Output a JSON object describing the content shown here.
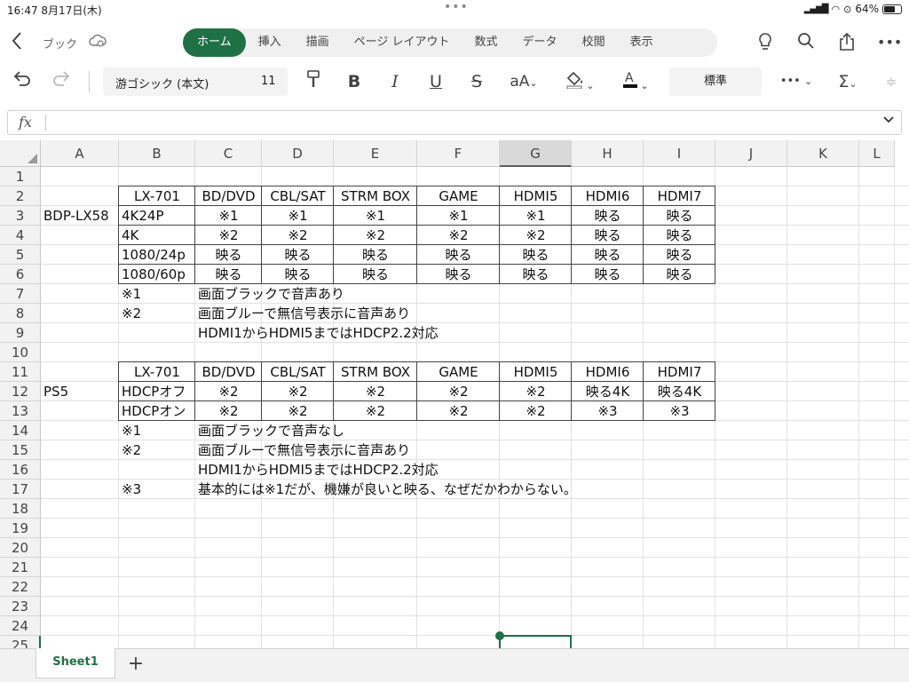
{
  "status": {
    "time": "16:47",
    "date": "8月17日(木)",
    "battery_text": "64%",
    "battery_level": 0.64
  },
  "ribbon": {
    "breadcrumb": "ブック",
    "tabs": [
      "ホーム",
      "挿入",
      "描画",
      "ページ レイアウト",
      "数式",
      "データ",
      "校閲",
      "表示"
    ],
    "active_tab": "ホーム"
  },
  "toolbar": {
    "font_name": "游ゴシック (本文)",
    "font_size": "11",
    "number_format": "標準"
  },
  "formula_bar": {
    "fx_label": "fx",
    "value": ""
  },
  "columns": [
    "A",
    "B",
    "C",
    "D",
    "E",
    "F",
    "G",
    "H",
    "I",
    "J",
    "K",
    "L"
  ],
  "selected_column": "G",
  "rows": [
    "1",
    "2",
    "3",
    "4",
    "5",
    "6",
    "7",
    "8",
    "9",
    "10",
    "11",
    "12",
    "13",
    "14",
    "15",
    "16",
    "17",
    "18",
    "19",
    "20",
    "21",
    "22",
    "23",
    "24",
    "25"
  ],
  "cells": [
    {
      "r": 2,
      "c": "B",
      "v": "LX-701",
      "al": "c"
    },
    {
      "r": 2,
      "c": "C",
      "v": "BD/DVD",
      "al": "c"
    },
    {
      "r": 2,
      "c": "D",
      "v": "CBL/SAT",
      "al": "c"
    },
    {
      "r": 2,
      "c": "E",
      "v": "STRM BOX",
      "al": "c"
    },
    {
      "r": 2,
      "c": "F",
      "v": "GAME",
      "al": "c"
    },
    {
      "r": 2,
      "c": "G",
      "v": "HDMI5",
      "al": "c"
    },
    {
      "r": 2,
      "c": "H",
      "v": "HDMI6",
      "al": "c"
    },
    {
      "r": 2,
      "c": "I",
      "v": "HDMI7",
      "al": "c"
    },
    {
      "r": 3,
      "c": "A",
      "v": "BDP-LX58",
      "al": "l"
    },
    {
      "r": 3,
      "c": "B",
      "v": "4K24P",
      "al": "l"
    },
    {
      "r": 3,
      "c": "C",
      "v": "※1",
      "al": "c"
    },
    {
      "r": 3,
      "c": "D",
      "v": "※1",
      "al": "c"
    },
    {
      "r": 3,
      "c": "E",
      "v": "※1",
      "al": "c"
    },
    {
      "r": 3,
      "c": "F",
      "v": "※1",
      "al": "c"
    },
    {
      "r": 3,
      "c": "G",
      "v": "※1",
      "al": "c"
    },
    {
      "r": 3,
      "c": "H",
      "v": "映る",
      "al": "c"
    },
    {
      "r": 3,
      "c": "I",
      "v": "映る",
      "al": "c"
    },
    {
      "r": 4,
      "c": "B",
      "v": "4K",
      "al": "l"
    },
    {
      "r": 4,
      "c": "C",
      "v": "※2",
      "al": "c"
    },
    {
      "r": 4,
      "c": "D",
      "v": "※2",
      "al": "c"
    },
    {
      "r": 4,
      "c": "E",
      "v": "※2",
      "al": "c"
    },
    {
      "r": 4,
      "c": "F",
      "v": "※2",
      "al": "c"
    },
    {
      "r": 4,
      "c": "G",
      "v": "※2",
      "al": "c"
    },
    {
      "r": 4,
      "c": "H",
      "v": "映る",
      "al": "c"
    },
    {
      "r": 4,
      "c": "I",
      "v": "映る",
      "al": "c"
    },
    {
      "r": 5,
      "c": "B",
      "v": "1080/24p",
      "al": "l"
    },
    {
      "r": 5,
      "c": "C",
      "v": "映る",
      "al": "c"
    },
    {
      "r": 5,
      "c": "D",
      "v": "映る",
      "al": "c"
    },
    {
      "r": 5,
      "c": "E",
      "v": "映る",
      "al": "c"
    },
    {
      "r": 5,
      "c": "F",
      "v": "映る",
      "al": "c"
    },
    {
      "r": 5,
      "c": "G",
      "v": "映る",
      "al": "c"
    },
    {
      "r": 5,
      "c": "H",
      "v": "映る",
      "al": "c"
    },
    {
      "r": 5,
      "c": "I",
      "v": "映る",
      "al": "c"
    },
    {
      "r": 6,
      "c": "B",
      "v": "1080/60p",
      "al": "l"
    },
    {
      "r": 6,
      "c": "C",
      "v": "映る",
      "al": "c"
    },
    {
      "r": 6,
      "c": "D",
      "v": "映る",
      "al": "c"
    },
    {
      "r": 6,
      "c": "E",
      "v": "映る",
      "al": "c"
    },
    {
      "r": 6,
      "c": "F",
      "v": "映る",
      "al": "c"
    },
    {
      "r": 6,
      "c": "G",
      "v": "映る",
      "al": "c"
    },
    {
      "r": 6,
      "c": "H",
      "v": "映る",
      "al": "c"
    },
    {
      "r": 6,
      "c": "I",
      "v": "映る",
      "al": "c"
    },
    {
      "r": 7,
      "c": "B",
      "v": "※1",
      "al": "l"
    },
    {
      "r": 7,
      "c": "C",
      "v": "画面ブラックで音声あり",
      "al": "l"
    },
    {
      "r": 8,
      "c": "B",
      "v": "※2",
      "al": "l"
    },
    {
      "r": 8,
      "c": "C",
      "v": "画面ブルーで無信号表示に音声あり",
      "al": "l"
    },
    {
      "r": 9,
      "c": "C",
      "v": "HDMI1からHDMI5まではHDCP2.2対応",
      "al": "l"
    },
    {
      "r": 11,
      "c": "B",
      "v": "LX-701",
      "al": "c"
    },
    {
      "r": 11,
      "c": "C",
      "v": "BD/DVD",
      "al": "c"
    },
    {
      "r": 11,
      "c": "D",
      "v": "CBL/SAT",
      "al": "c"
    },
    {
      "r": 11,
      "c": "E",
      "v": "STRM BOX",
      "al": "c"
    },
    {
      "r": 11,
      "c": "F",
      "v": "GAME",
      "al": "c"
    },
    {
      "r": 11,
      "c": "G",
      "v": "HDMI5",
      "al": "c"
    },
    {
      "r": 11,
      "c": "H",
      "v": "HDMI6",
      "al": "c"
    },
    {
      "r": 11,
      "c": "I",
      "v": "HDMI7",
      "al": "c"
    },
    {
      "r": 12,
      "c": "A",
      "v": "PS5",
      "al": "l"
    },
    {
      "r": 12,
      "c": "B",
      "v": "HDCPオフ",
      "al": "l"
    },
    {
      "r": 12,
      "c": "C",
      "v": "※2",
      "al": "c"
    },
    {
      "r": 12,
      "c": "D",
      "v": "※2",
      "al": "c"
    },
    {
      "r": 12,
      "c": "E",
      "v": "※2",
      "al": "c"
    },
    {
      "r": 12,
      "c": "F",
      "v": "※2",
      "al": "c"
    },
    {
      "r": 12,
      "c": "G",
      "v": "※2",
      "al": "c"
    },
    {
      "r": 12,
      "c": "H",
      "v": "映る4K",
      "al": "c"
    },
    {
      "r": 12,
      "c": "I",
      "v": "映る4K",
      "al": "c"
    },
    {
      "r": 13,
      "c": "B",
      "v": "HDCPオン",
      "al": "l"
    },
    {
      "r": 13,
      "c": "C",
      "v": "※2",
      "al": "c"
    },
    {
      "r": 13,
      "c": "D",
      "v": "※2",
      "al": "c"
    },
    {
      "r": 13,
      "c": "E",
      "v": "※2",
      "al": "c"
    },
    {
      "r": 13,
      "c": "F",
      "v": "※2",
      "al": "c"
    },
    {
      "r": 13,
      "c": "G",
      "v": "※2",
      "al": "c"
    },
    {
      "r": 13,
      "c": "H",
      "v": "※3",
      "al": "c"
    },
    {
      "r": 13,
      "c": "I",
      "v": "※3",
      "al": "c"
    },
    {
      "r": 14,
      "c": "B",
      "v": "※1",
      "al": "l"
    },
    {
      "r": 14,
      "c": "C",
      "v": "画面ブラックで音声なし",
      "al": "l"
    },
    {
      "r": 15,
      "c": "B",
      "v": "※2",
      "al": "l"
    },
    {
      "r": 15,
      "c": "C",
      "v": "画面ブルーで無信号表示に音声あり",
      "al": "l"
    },
    {
      "r": 16,
      "c": "C",
      "v": "HDMI1からHDMI5まではHDCP2.2対応",
      "al": "l"
    },
    {
      "r": 17,
      "c": "B",
      "v": "※3",
      "al": "l"
    },
    {
      "r": 17,
      "c": "C",
      "v": "基本的には※1だが、機嫌が良いと映る、なぜだかわからない。",
      "al": "l"
    }
  ],
  "sheets": {
    "active": "Sheet1",
    "add_label": "+"
  },
  "colors": {
    "accent": "#1f7145"
  }
}
